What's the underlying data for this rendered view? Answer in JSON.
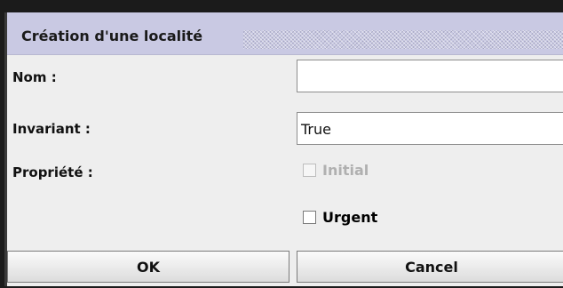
{
  "dialog": {
    "title": "Création d'une localité"
  },
  "form": {
    "nom_label": "Nom :",
    "nom_value": "",
    "invariant_label": "Invariant :",
    "invariant_value": "True",
    "propriete_label": "Propriété :",
    "initial_label": "Initial",
    "initial_checked": false,
    "initial_enabled": false,
    "urgent_label": "Urgent",
    "urgent_checked": false
  },
  "buttons": {
    "ok_label": "OK",
    "cancel_label": "Cancel"
  },
  "colors": {
    "titlebar": "#c9c9e3",
    "dialog_bg": "#eeeeee",
    "disabled_text": "#b0b0b0"
  }
}
